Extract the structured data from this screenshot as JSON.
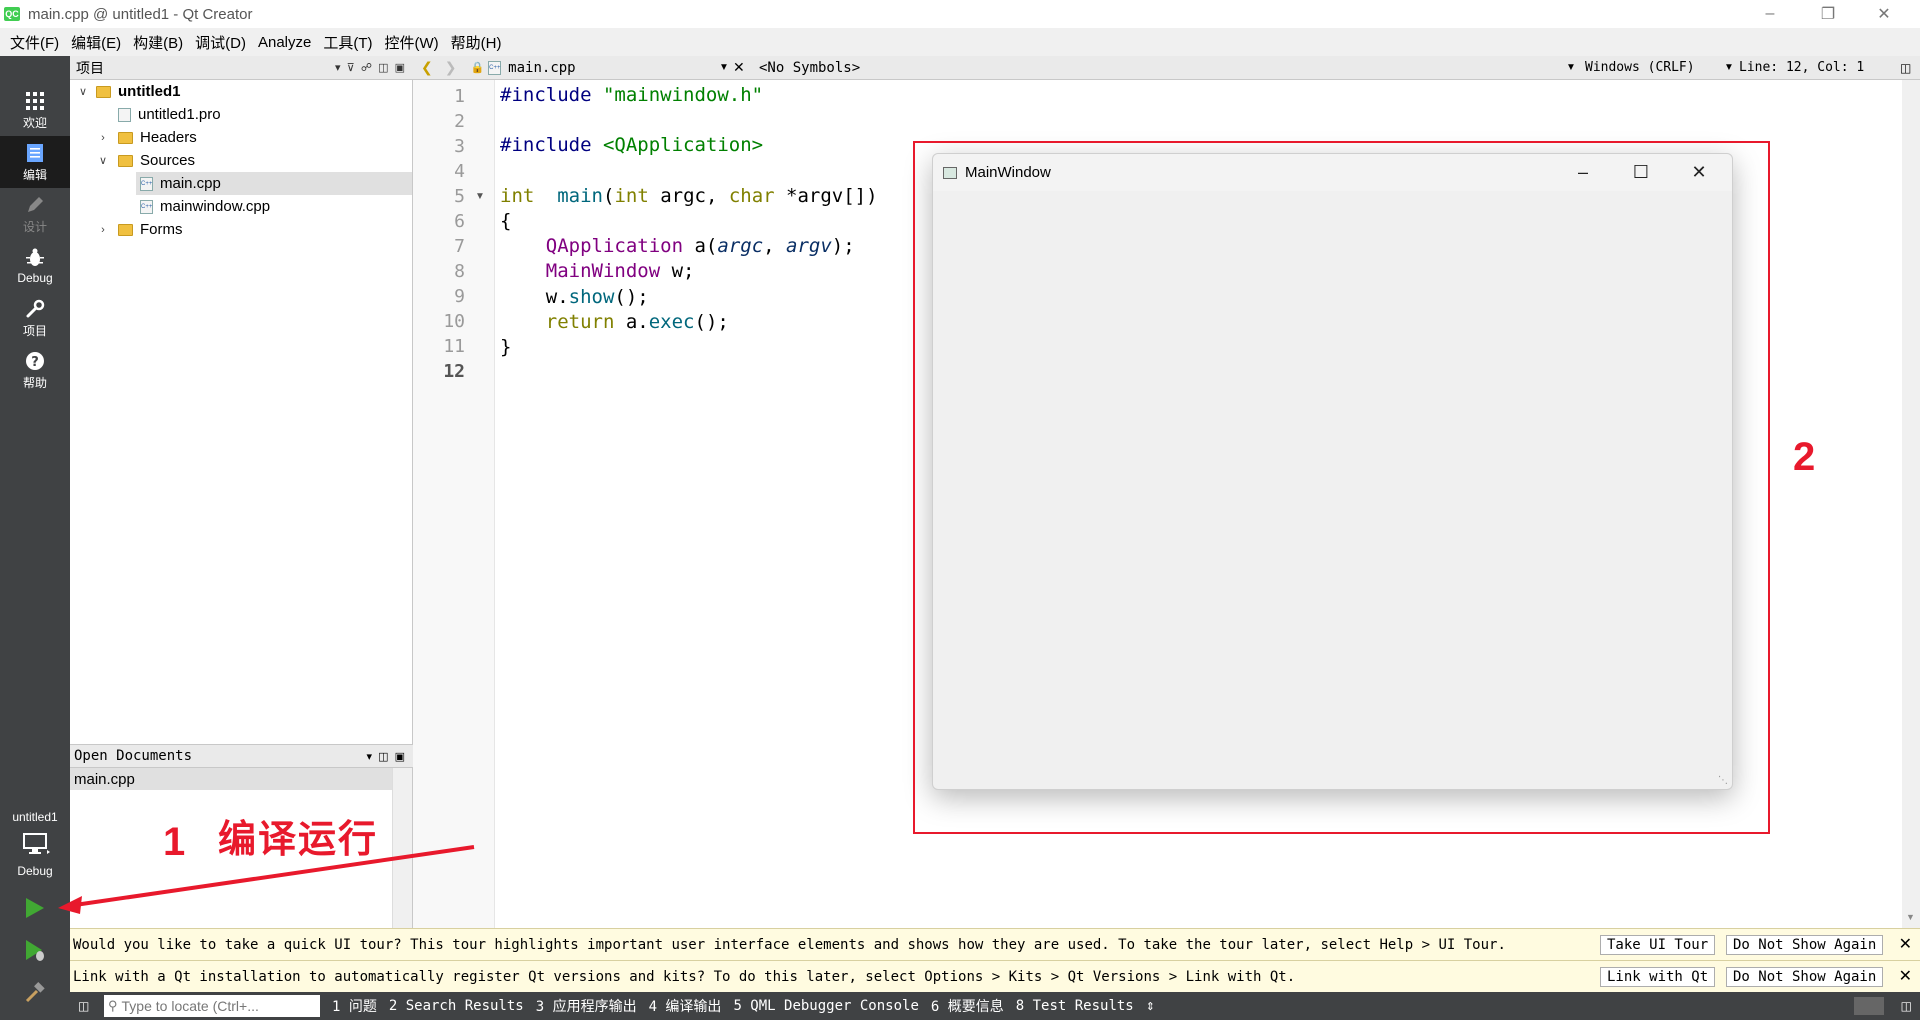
{
  "window": {
    "title": "main.cpp @ untitled1 - Qt Creator",
    "logo": "QC"
  },
  "menu": [
    "文件(F)",
    "编辑(E)",
    "构建(B)",
    "调试(D)",
    "Analyze",
    "工具(T)",
    "控件(W)",
    "帮助(H)"
  ],
  "modes": [
    {
      "label": "欢迎",
      "icon": "grid-icon"
    },
    {
      "label": "编辑",
      "icon": "document-icon"
    },
    {
      "label": "设计",
      "icon": "pencil-icon"
    },
    {
      "label": "Debug",
      "icon": "bug-icon"
    },
    {
      "label": "项目",
      "icon": "wrench-icon"
    },
    {
      "label": "帮助",
      "icon": "help-icon"
    }
  ],
  "kit": {
    "project": "untitled1",
    "config": "Debug"
  },
  "projects": {
    "header": "项目",
    "tree": [
      {
        "label": "untitled1"
      },
      {
        "label": "untitled1.pro"
      },
      {
        "label": "Headers"
      },
      {
        "label": "Sources"
      },
      {
        "label": "main.cpp"
      },
      {
        "label": "mainwindow.cpp"
      },
      {
        "label": "Forms"
      }
    ]
  },
  "open_documents": {
    "header": "Open Documents",
    "items": [
      "main.cpp"
    ]
  },
  "editor": {
    "file": "main.cpp",
    "symbols": "<No Symbols>",
    "line_ending": "Windows (CRLF)",
    "position": "Line: 12, Col: 1",
    "line_numbers": [
      "1",
      "2",
      "3",
      "4",
      "5",
      "6",
      "7",
      "8",
      "9",
      "10",
      "11",
      "12"
    ],
    "code": [
      [
        [
          "pp",
          "#include "
        ],
        [
          "st",
          "\"mainwindow.h\""
        ]
      ],
      [],
      [
        [
          "pp",
          "#include "
        ],
        [
          "st",
          "<QApplication>"
        ]
      ],
      [],
      [
        [
          "kw",
          "int"
        ],
        [
          "",
          "  "
        ],
        [
          "fn",
          "main"
        ],
        [
          "",
          "("
        ],
        [
          "kw",
          "int"
        ],
        [
          "",
          " argc, "
        ],
        [
          "kw",
          "char"
        ],
        [
          "",
          " *argv[])"
        ]
      ],
      [
        [
          "",
          "{"
        ]
      ],
      [
        [
          "",
          "    "
        ],
        [
          "ty",
          "QApplication"
        ],
        [
          "",
          " a("
        ],
        [
          "it",
          "argc"
        ],
        [
          "",
          ", "
        ],
        [
          "it",
          "argv"
        ],
        [
          "",
          ");"
        ]
      ],
      [
        [
          "",
          "    "
        ],
        [
          "ty",
          "MainWindow"
        ],
        [
          "",
          " w;"
        ]
      ],
      [
        [
          "",
          "    w."
        ],
        [
          "fn",
          "show"
        ],
        [
          "",
          "();"
        ]
      ],
      [
        [
          "",
          "    "
        ],
        [
          "kw",
          "return"
        ],
        [
          "",
          " a."
        ],
        [
          "fn",
          "exec"
        ],
        [
          "",
          "();"
        ]
      ],
      [
        [
          "",
          "}"
        ]
      ],
      []
    ]
  },
  "app_window": {
    "title": "MainWindow"
  },
  "annotations": {
    "label1": "1",
    "label2": "2",
    "run_label": "编译运行"
  },
  "info_bars": [
    {
      "message": "Would you like to take a quick UI tour? This tour highlights important user interface elements and shows how they are used. To take the tour later, select Help > UI Tour.",
      "button1": "Take UI Tour",
      "button2": "Do Not Show Again"
    },
    {
      "message": "Link with a Qt installation to automatically register Qt versions and kits? To do this later, select Options > Kits > Qt Versions > Link with Qt.",
      "button1": "Link with Qt",
      "button2": "Do Not Show Again"
    }
  ],
  "status": {
    "locate_placeholder": "Type to locate (Ctrl+...",
    "panes": [
      "1 问题",
      "2 Search Results",
      "3 应用程序输出",
      "4 编译输出",
      "5 QML Debugger Console",
      "6 概要信息",
      "8 Test Results"
    ]
  },
  "colors": {
    "accent_red": "#e8192c",
    "modebar": "#404244",
    "run_green": "#41a833"
  }
}
